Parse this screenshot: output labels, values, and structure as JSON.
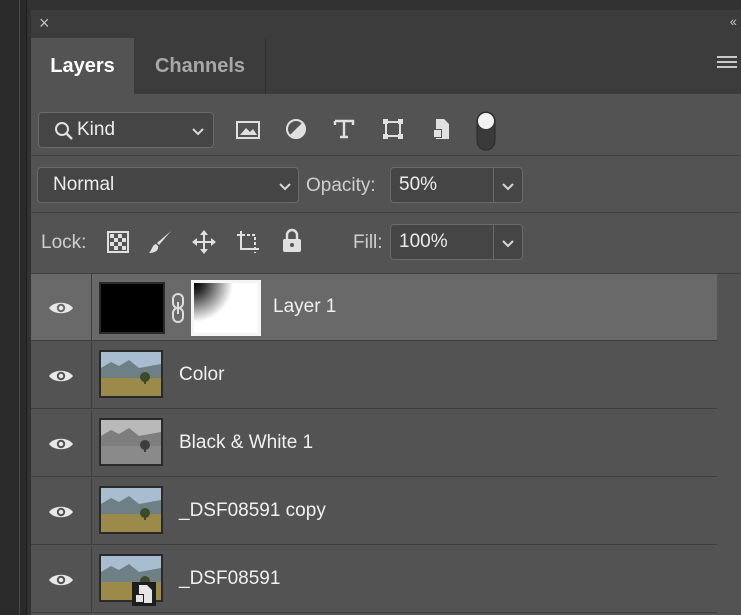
{
  "panel": {
    "close_glyph": "×",
    "collapse_glyph": "‹‹",
    "tabs": [
      {
        "label": "Layers",
        "active": true
      },
      {
        "label": "Channels",
        "active": false
      }
    ]
  },
  "filter": {
    "kind_label": "Kind",
    "icons": [
      "image-filter-icon",
      "adjustment-filter-icon",
      "type-filter-icon",
      "shape-filter-icon",
      "smart-object-filter-icon",
      "filter-toggle-icon"
    ]
  },
  "blend": {
    "mode": "Normal",
    "opacity_label": "Opacity:",
    "opacity_value": "50%"
  },
  "lock": {
    "label": "Lock:",
    "fill_label": "Fill:",
    "fill_value": "100%"
  },
  "layers": [
    {
      "name": "Layer 1",
      "selected": true,
      "thumb": "black-fill",
      "has_mask": true
    },
    {
      "name": "Color",
      "selected": false,
      "thumb": "landscape-color"
    },
    {
      "name": "Black & White 1",
      "selected": false,
      "thumb": "landscape-bw"
    },
    {
      "name": "_DSF08591 copy",
      "selected": false,
      "thumb": "landscape-color"
    },
    {
      "name": "_DSF08591",
      "selected": false,
      "thumb": "landscape-color",
      "smart_object": true
    }
  ],
  "colors": {
    "panel_bg": "#535353",
    "selected_row": "#696969",
    "tab_bar": "#3c3c3c"
  }
}
